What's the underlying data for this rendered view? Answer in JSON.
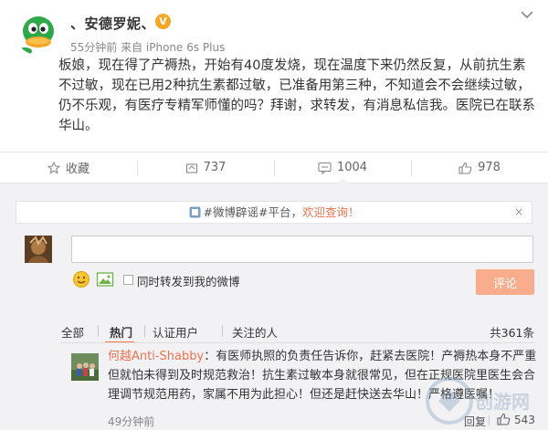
{
  "post": {
    "user_name": "、安德罗妮、",
    "verified_badge": "V",
    "meta": "55分钟前 来自 iPhone 6s Plus",
    "text": "板娘，现在得了产褥热，开始有40度发烧，现在温度下来仍然反复，从前抗生素不过敏，现在已用2种抗生素都过敏，已准备用第三种，不知道会不会继续过敏，仍不乐观，有医疗专精军师懂的吗？拜谢，求转发，有消息私信我。医院已在联系华山。",
    "avatar_icon": "duck-avatar-icon",
    "menu_icon": "chevron-down-icon"
  },
  "actions": [
    {
      "name": "favorite",
      "label": "收藏",
      "icon": "star-icon"
    },
    {
      "name": "repost",
      "label": "737",
      "icon": "repost-icon"
    },
    {
      "name": "comment",
      "label": "1004",
      "icon": "comment-icon"
    },
    {
      "name": "like",
      "label": "978",
      "icon": "thumbs-up-icon"
    }
  ],
  "comments": {
    "notice": {
      "prefix": "#微博辟谣#平台，",
      "link": "欢迎查询！",
      "close": "×"
    },
    "input_value": "",
    "repost_checkbox_label": "同时转发到我的微博",
    "submit_label": "评论",
    "filters": [
      "全部",
      "热门",
      "认证用户",
      "关注的人"
    ],
    "total_count": "共361条",
    "items": [
      {
        "user": "何越Anti-Shabby",
        "text": "：有医师执照的负责任告诉你，赶紧去医院！产褥热本身不严重但就怕未得到及时规范救治！抗生素过敏本身就很常见，但在正规医院里医生会合理调节规范用药，家属不用为此担心！但还是赶快送去华山！严格遵医嘱！",
        "time": "49分钟前",
        "reply_label": "回复",
        "likes": "543"
      }
    ]
  },
  "watermark_text": "创游网",
  "colors": {
    "accent": "#eb7350",
    "submit": "#f9ad8d",
    "badge": "#f5a623",
    "panel_bg": "#f2f2f5"
  }
}
